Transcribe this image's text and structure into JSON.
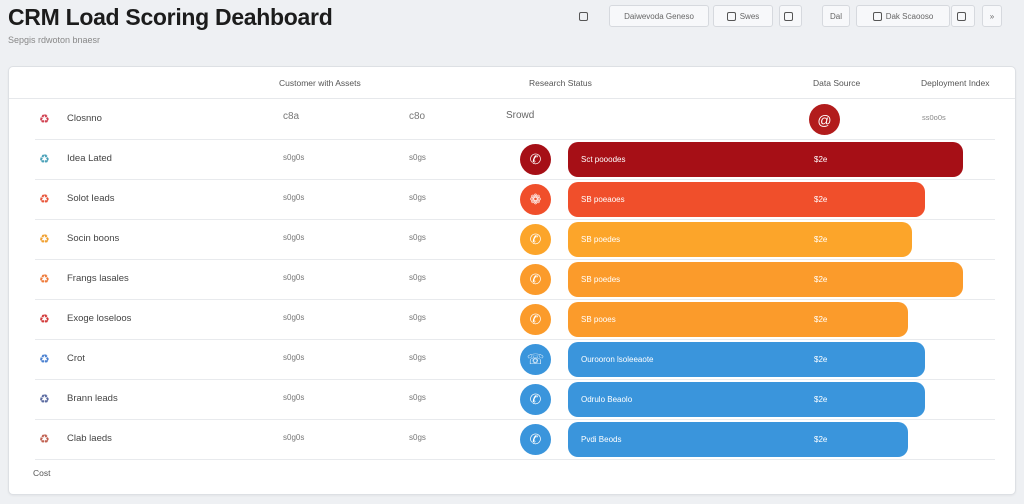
{
  "header": {
    "title": "CRM Load Scoring Deahboard",
    "subtitle": "Sepgis rdwoton bnaesr"
  },
  "toolbar": [
    {
      "label": "",
      "icon": "settings-icon"
    },
    {
      "label": "Daiwevoda Geneso",
      "icon": ""
    },
    {
      "label": "Swes",
      "icon": "save-icon"
    },
    {
      "label": "",
      "icon": "refresh-icon"
    },
    {
      "label": "Dal",
      "icon": ""
    },
    {
      "label": "Dak Scaooso",
      "icon": "filter-icon"
    },
    {
      "label": "",
      "icon": "share-icon"
    },
    {
      "label": "»",
      "icon": ""
    }
  ],
  "table": {
    "headers": [
      "Customer with Assets",
      "Research Status",
      "Data Source",
      "Deployment Index"
    ],
    "summary": {
      "name": "Closnno",
      "c1": "c8a",
      "c2": "c8o",
      "status": "Srowd",
      "index": "ss0o0s"
    },
    "rows": [
      {
        "name": "Idea Lated",
        "c1": "s0g0s",
        "c2": "s0gs",
        "status": "Sct pooodes",
        "value": "$2e",
        "color": "#a60f16",
        "icon": "phone-icon",
        "fill": 0.93,
        "symcolor": "#4aa1b8"
      },
      {
        "name": "Solot Ieads",
        "c1": "s0g0s",
        "c2": "s0gs",
        "status": "SB poeaoes",
        "value": "$2e",
        "color": "#f04f2b",
        "icon": "cookie-icon",
        "fill": 0.84,
        "symcolor": "#e8553a"
      },
      {
        "name": "Socin boons",
        "c1": "s0g0s",
        "c2": "s0gs",
        "status": "SB poedes",
        "value": "$2e",
        "color": "#fca52a",
        "icon": "phone-icon",
        "fill": 0.81,
        "symcolor": "#f0a030"
      },
      {
        "name": "Frangs lasales",
        "c1": "s0g0s",
        "c2": "s0gs",
        "status": "SB poedes",
        "value": "$2e",
        "color": "#fb9b2b",
        "icon": "phone-icon",
        "fill": 0.93,
        "symcolor": "#ee7a3a"
      },
      {
        "name": "Exoge loseloos",
        "c1": "s0g0s",
        "c2": "s0gs",
        "status": "SB pooes",
        "value": "$2e",
        "color": "#fb9b2b",
        "icon": "phone-icon",
        "fill": 0.8,
        "symcolor": "#d23a3a"
      },
      {
        "name": "Crot",
        "c1": "s0g0s",
        "c2": "s0gs",
        "status": "Ourooron lsoleeaote",
        "value": "$2e",
        "color": "#3a95dc",
        "icon": "chat-icon",
        "fill": 0.84,
        "symcolor": "#4a80d0"
      },
      {
        "name": "Brann leads",
        "c1": "s0g0s",
        "c2": "s0gs",
        "status": "Odrulo Beaolo",
        "value": "$2e",
        "color": "#3a95dc",
        "icon": "phone-icon",
        "fill": 0.84,
        "symcolor": "#5a6aa0"
      },
      {
        "name": "Clab laeds",
        "c1": "s0g0s",
        "c2": "s0gs",
        "status": "Pvdi Beods",
        "value": "$2e",
        "color": "#3a95dc",
        "icon": "phone-icon",
        "fill": 0.8,
        "symcolor": "#c06050"
      }
    ],
    "footer": "Cost"
  }
}
